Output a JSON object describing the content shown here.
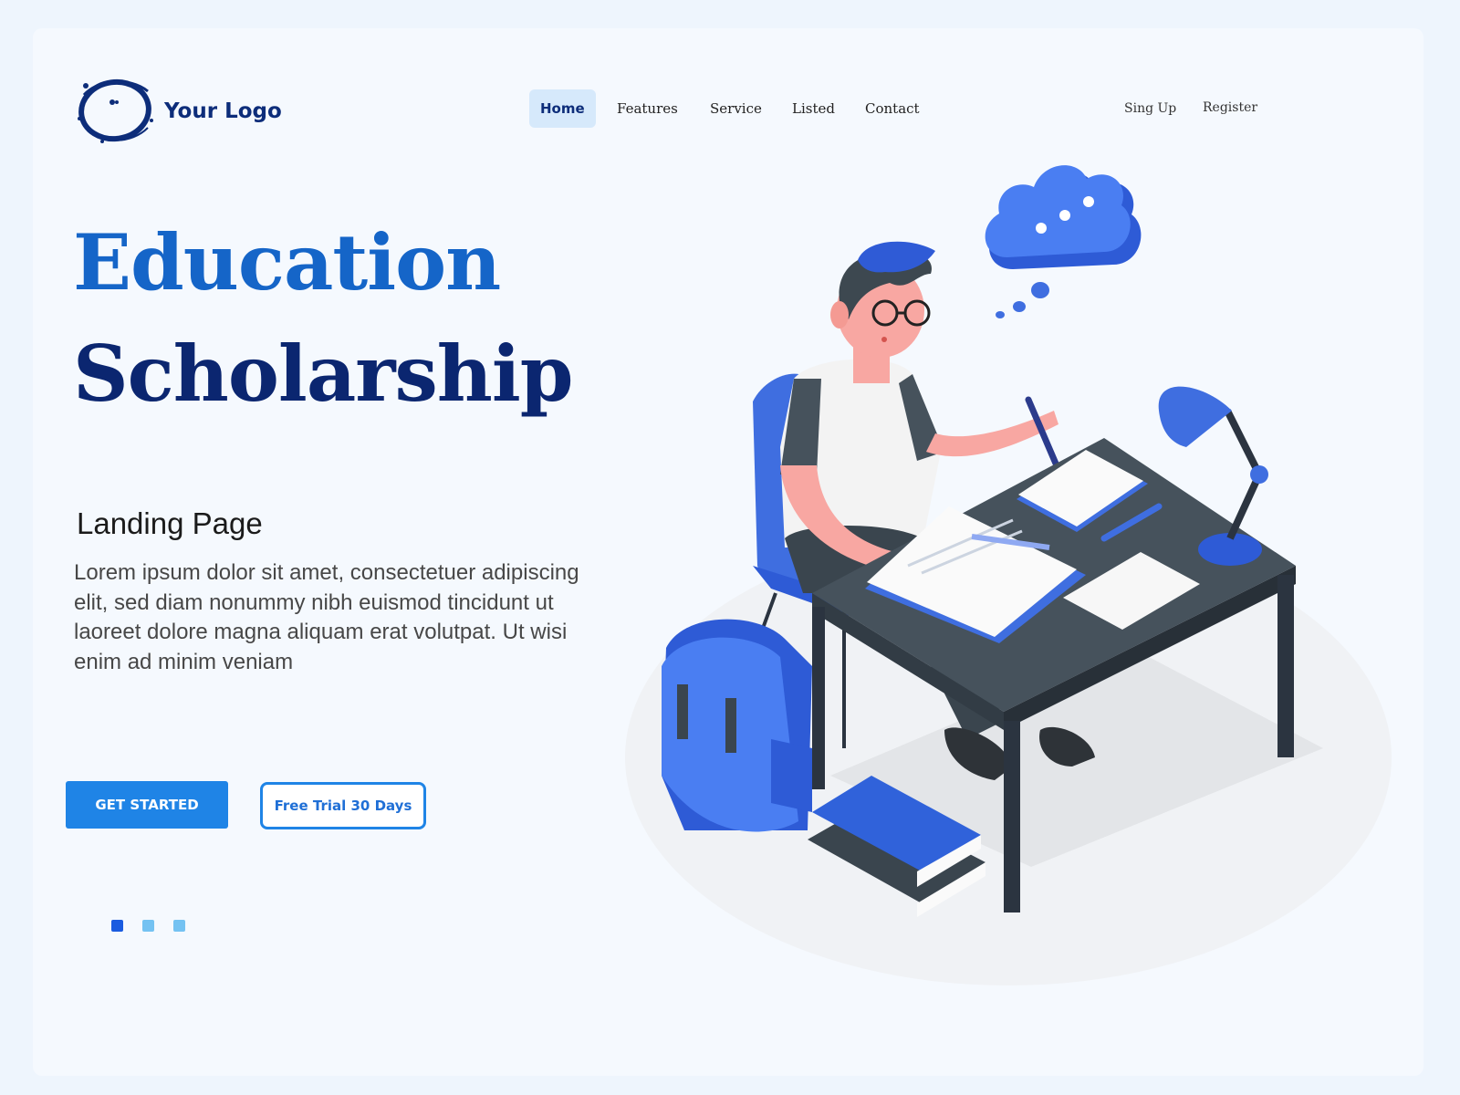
{
  "logo": {
    "text": "Your Logo"
  },
  "nav": {
    "items": [
      {
        "label": "Home",
        "active": true
      },
      {
        "label": "Features",
        "active": false
      },
      {
        "label": "Service",
        "active": false
      },
      {
        "label": "Listed",
        "active": false
      },
      {
        "label": "Contact",
        "active": false
      }
    ]
  },
  "auth": {
    "signup_label": "Sing Up",
    "register_label": "Register"
  },
  "hero": {
    "title_line1": "Education",
    "title_line2": "Scholarship",
    "subtitle": "Landing Page",
    "body": "Lorem ipsum dolor sit amet, consectetuer adipiscing elit, sed diam nonummy nibh euismod tincidunt ut laoreet dolore magna aliquam erat volutpat. Ut wisi enim ad minim veniam"
  },
  "buttons": {
    "primary_label": "GET STARTED",
    "secondary_label": "Free Trial 30 Days"
  },
  "pager": {
    "count": 3,
    "active_index": 0
  },
  "colors": {
    "accent": "#1f84e6",
    "title_light": "#1565c8",
    "title_dark": "#0b2670",
    "dot_active": "#1a5be0",
    "dot_inactive": "#74c2f2"
  },
  "icons": {
    "logo": "ink-circle-logo-icon"
  }
}
